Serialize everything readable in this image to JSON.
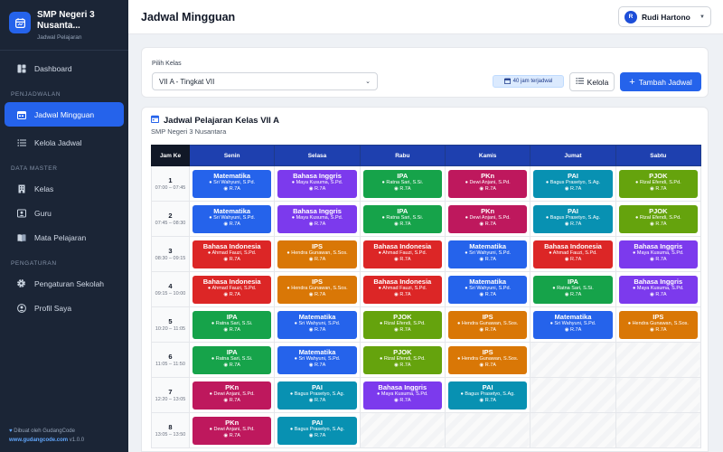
{
  "brand": {
    "name": "SMP Negeri 3 Nusanta...",
    "subtitle": "Jadwal Pelajaran"
  },
  "sidebar": {
    "sections": [
      {
        "title": "",
        "items": [
          {
            "label": "Dashboard",
            "icon": "dashboard-icon"
          }
        ]
      },
      {
        "title": "PENJADWALAN",
        "items": [
          {
            "label": "Jadwal Mingguan",
            "icon": "calendar-icon",
            "active": true
          },
          {
            "label": "Kelola Jadwal",
            "icon": "list-icon"
          }
        ]
      },
      {
        "title": "DATA MASTER",
        "items": [
          {
            "label": "Kelas",
            "icon": "building-icon"
          },
          {
            "label": "Guru",
            "icon": "person-card-icon"
          },
          {
            "label": "Mata Pelajaran",
            "icon": "book-icon"
          }
        ]
      },
      {
        "title": "PENGATURAN",
        "items": [
          {
            "label": "Pengaturan Sekolah",
            "icon": "gear-icon"
          },
          {
            "label": "Profil Saya",
            "icon": "user-icon"
          }
        ]
      }
    ],
    "footer": {
      "made_by": "Dibuat oleh GudangCode",
      "url": "www.gudangcode.com",
      "version": "v1.0.0"
    }
  },
  "header": {
    "title": "Jadwal Mingguan",
    "user": {
      "initial": "R",
      "name": "Rudi Hartono"
    }
  },
  "filter": {
    "label": "Pilih Kelas",
    "selected": "VII A - Tingkat VII",
    "hours_badge": "40 jam terjadwal",
    "kelola_label": "Kelola",
    "add_label": "Tambah Jadwal"
  },
  "schedule": {
    "title": "Jadwal Pelajaran Kelas VII A",
    "school": "SMP Negeri 3 Nusantara",
    "columns": [
      "Jam Ke",
      "Senin",
      "Selasa",
      "Rabu",
      "Kamis",
      "Jumat",
      "Sabtu"
    ],
    "colors": {
      "mtk": "#2563eb",
      "bing": "#7c3aed",
      "ipa": "#16a34a",
      "pkn": "#be185d",
      "pai": "#0891b2",
      "pjok": "#65a30d",
      "bind": "#dc2626",
      "ips": "#d97706"
    },
    "rows": [
      {
        "jam": "1",
        "time": "07:00 – 07:45",
        "cells": [
          {
            "subject": "Matematika",
            "teacher": "Sri Wahyuni, S.Pd.",
            "room": "R.7A",
            "c": "mtk"
          },
          {
            "subject": "Bahasa Inggris",
            "teacher": "Maya Kusuma, S.Pd.",
            "room": "R.7A",
            "c": "bing"
          },
          {
            "subject": "IPA",
            "teacher": "Ratna Sari, S.Si.",
            "room": "R.7A",
            "c": "ipa"
          },
          {
            "subject": "PKn",
            "teacher": "Dewi Anjani, S.Pd.",
            "room": "R.7A",
            "c": "pkn"
          },
          {
            "subject": "PAI",
            "teacher": "Bagus Prasetyo, S.Ag.",
            "room": "R.7A",
            "c": "pai"
          },
          {
            "subject": "PJOK",
            "teacher": "Rizal Efendi, S.Pd.",
            "room": "R.7A",
            "c": "pjok"
          }
        ]
      },
      {
        "jam": "2",
        "time": "07:45 – 08:30",
        "cells": [
          {
            "subject": "Matematika",
            "teacher": "Sri Wahyuni, S.Pd.",
            "room": "R.7A",
            "c": "mtk"
          },
          {
            "subject": "Bahasa Inggris",
            "teacher": "Maya Kusuma, S.Pd.",
            "room": "R.7A",
            "c": "bing"
          },
          {
            "subject": "IPA",
            "teacher": "Ratna Sari, S.Si.",
            "room": "R.7A",
            "c": "ipa"
          },
          {
            "subject": "PKn",
            "teacher": "Dewi Anjani, S.Pd.",
            "room": "R.7A",
            "c": "pkn"
          },
          {
            "subject": "PAI",
            "teacher": "Bagus Prasetyo, S.Ag.",
            "room": "R.7A",
            "c": "pai"
          },
          {
            "subject": "PJOK",
            "teacher": "Rizal Efendi, S.Pd.",
            "room": "R.7A",
            "c": "pjok"
          }
        ]
      },
      {
        "jam": "3",
        "time": "08:30 – 09:15",
        "cells": [
          {
            "subject": "Bahasa Indonesia",
            "teacher": "Ahmad Fauzi, S.Pd.",
            "room": "R.7A",
            "c": "bind"
          },
          {
            "subject": "IPS",
            "teacher": "Hendra Gunawan, S.Sos.",
            "room": "R.7A",
            "c": "ips"
          },
          {
            "subject": "Bahasa Indonesia",
            "teacher": "Ahmad Fauzi, S.Pd.",
            "room": "R.7A",
            "c": "bind"
          },
          {
            "subject": "Matematika",
            "teacher": "Sri Wahyuni, S.Pd.",
            "room": "R.7A",
            "c": "mtk"
          },
          {
            "subject": "Bahasa Indonesia",
            "teacher": "Ahmad Fauzi, S.Pd.",
            "room": "R.7A",
            "c": "bind"
          },
          {
            "subject": "Bahasa Inggris",
            "teacher": "Maya Kusuma, S.Pd.",
            "room": "R.7A",
            "c": "bing"
          }
        ]
      },
      {
        "jam": "4",
        "time": "09:15 – 10:00",
        "cells": [
          {
            "subject": "Bahasa Indonesia",
            "teacher": "Ahmad Fauzi, S.Pd.",
            "room": "R.7A",
            "c": "bind"
          },
          {
            "subject": "IPS",
            "teacher": "Hendra Gunawan, S.Sos.",
            "room": "R.7A",
            "c": "ips"
          },
          {
            "subject": "Bahasa Indonesia",
            "teacher": "Ahmad Fauzi, S.Pd.",
            "room": "R.7A",
            "c": "bind"
          },
          {
            "subject": "Matematika",
            "teacher": "Sri Wahyuni, S.Pd.",
            "room": "R.7A",
            "c": "mtk"
          },
          {
            "subject": "IPA",
            "teacher": "Ratna Sari, S.Si.",
            "room": "R.7A",
            "c": "ipa"
          },
          {
            "subject": "Bahasa Inggris",
            "teacher": "Maya Kusuma, S.Pd.",
            "room": "R.7A",
            "c": "bing"
          }
        ]
      },
      {
        "jam": "5",
        "time": "10:20 – 11:05",
        "cells": [
          {
            "subject": "IPA",
            "teacher": "Ratna Sari, S.Si.",
            "room": "R.7A",
            "c": "ipa"
          },
          {
            "subject": "Matematika",
            "teacher": "Sri Wahyuni, S.Pd.",
            "room": "R.7A",
            "c": "mtk"
          },
          {
            "subject": "PJOK",
            "teacher": "Rizal Efendi, S.Pd.",
            "room": "R.7A",
            "c": "pjok"
          },
          {
            "subject": "IPS",
            "teacher": "Hendra Gunawan, S.Sos.",
            "room": "R.7A",
            "c": "ips"
          },
          {
            "subject": "Matematika",
            "teacher": "Sri Wahyuni, S.Pd.",
            "room": "R.7A",
            "c": "mtk"
          },
          {
            "subject": "IPS",
            "teacher": "Hendra Gunawan, S.Sos.",
            "room": "R.7A",
            "c": "ips"
          }
        ]
      },
      {
        "jam": "6",
        "time": "11:05 – 11:50",
        "cells": [
          {
            "subject": "IPA",
            "teacher": "Ratna Sari, S.Si.",
            "room": "R.7A",
            "c": "ipa"
          },
          {
            "subject": "Matematika",
            "teacher": "Sri Wahyuni, S.Pd.",
            "room": "R.7A",
            "c": "mtk"
          },
          {
            "subject": "PJOK",
            "teacher": "Rizal Efendi, S.Pd.",
            "room": "R.7A",
            "c": "pjok"
          },
          {
            "subject": "IPS",
            "teacher": "Hendra Gunawan, S.Sos.",
            "room": "R.7A",
            "c": "ips"
          },
          null,
          null
        ]
      },
      {
        "jam": "7",
        "time": "12:20 – 13:05",
        "cells": [
          {
            "subject": "PKn",
            "teacher": "Dewi Anjani, S.Pd.",
            "room": "R.7A",
            "c": "pkn"
          },
          {
            "subject": "PAI",
            "teacher": "Bagus Prasetyo, S.Ag.",
            "room": "R.7A",
            "c": "pai"
          },
          {
            "subject": "Bahasa Inggris",
            "teacher": "Maya Kusuma, S.Pd.",
            "room": "R.7A",
            "c": "bing"
          },
          {
            "subject": "PAI",
            "teacher": "Bagus Prasetyo, S.Ag.",
            "room": "R.7A",
            "c": "pai"
          },
          null,
          null
        ]
      },
      {
        "jam": "8",
        "time": "13:05 – 13:50",
        "cells": [
          {
            "subject": "PKn",
            "teacher": "Dewi Anjani, S.Pd.",
            "room": "R.7A",
            "c": "pkn"
          },
          {
            "subject": "PAI",
            "teacher": "Bagus Prasetyo, S.Ag.",
            "room": "R.7A",
            "c": "pai"
          },
          null,
          null,
          null,
          null
        ]
      }
    ]
  }
}
